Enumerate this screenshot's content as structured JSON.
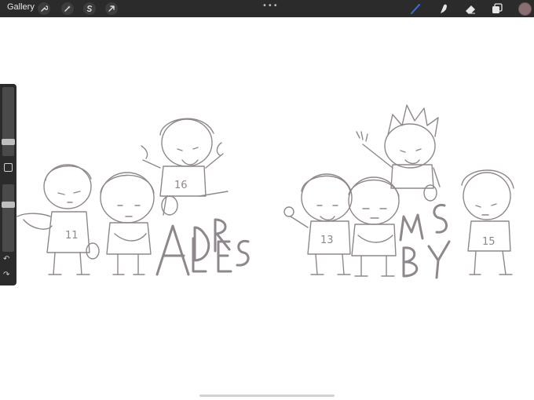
{
  "app": {
    "gallery_label": "Gallery",
    "more_menu": "•••"
  },
  "toolbar_left": {
    "icons": [
      "wrench-icon",
      "magic-wand-icon",
      "selection-s-icon",
      "transform-arrow-icon"
    ]
  },
  "toolbar_right": {
    "icons": [
      "brush-icon",
      "smudge-icon",
      "eraser-icon",
      "layers-icon"
    ],
    "active_tool": "brush",
    "active_color": "#8a6f72",
    "brush_color": "#3b6fd8"
  },
  "sidebar": {
    "brush_size_level": 0.35,
    "opacity_level": 0.35,
    "undo_glyph": "↶",
    "redo_glyph": "↷"
  },
  "canvas": {
    "lettering_left": "ADLER ES",
    "lettering_right": "MSBY",
    "jersey_numbers": [
      "11",
      "16",
      "13",
      "15"
    ]
  }
}
